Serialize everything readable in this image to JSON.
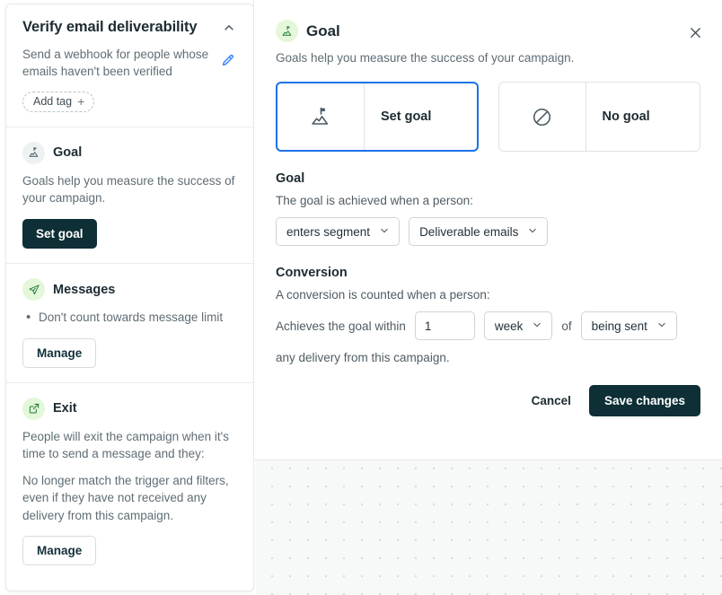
{
  "sidebar": {
    "header": {
      "title": "Verify email deliverability",
      "description": "Send a webhook for people whose emails haven't been verified",
      "collapse_icon": "chevron-up-icon",
      "edit_icon": "pencil-icon",
      "add_tag_label": "Add tag",
      "add_tag_plus": "+"
    },
    "goal": {
      "icon": "mountain-flag-icon",
      "title": "Goal",
      "text": "Goals help you measure the success of your campaign.",
      "button": "Set goal"
    },
    "messages": {
      "icon": "paper-plane-icon",
      "title": "Messages",
      "bullets": [
        "Don't count towards message limit"
      ],
      "button": "Manage"
    },
    "exit": {
      "icon": "external-link-icon",
      "title": "Exit",
      "text1": "People will exit the campaign when it's time to send a message and they:",
      "text2": "No longer match the trigger and filters, even if they have not received any delivery from this campaign.",
      "button": "Manage"
    }
  },
  "panel": {
    "icon": "mountain-flag-icon",
    "title": "Goal",
    "subtitle": "Goals help you measure the success of your campaign.",
    "close_icon": "close-icon",
    "choices": [
      {
        "label": "Set goal",
        "icon": "mountain-flag-icon",
        "selected": true
      },
      {
        "label": "No goal",
        "icon": "no-entry-icon",
        "selected": false
      }
    ],
    "goal_section": {
      "title": "Goal",
      "subtitle": "The goal is achieved when a person:",
      "trigger_select": "enters segment",
      "segment_select": "Deliverable emails"
    },
    "conversion_section": {
      "title": "Conversion",
      "subtitle": "A conversion is counted when a person:",
      "prefix": "Achieves the goal within",
      "amount_value": "1",
      "amount_placeholder": "1",
      "unit_select": "week",
      "middle": "of",
      "event_select": "being sent",
      "suffix": "any delivery from this campaign."
    },
    "actions": {
      "cancel": "Cancel",
      "save": "Save changes"
    }
  },
  "colors": {
    "accent_blue": "#1b72e8",
    "dark_button": "#0d2f35",
    "icon_green_bg": "#e4f7d9",
    "pencil_blue": "#2f7df6"
  }
}
